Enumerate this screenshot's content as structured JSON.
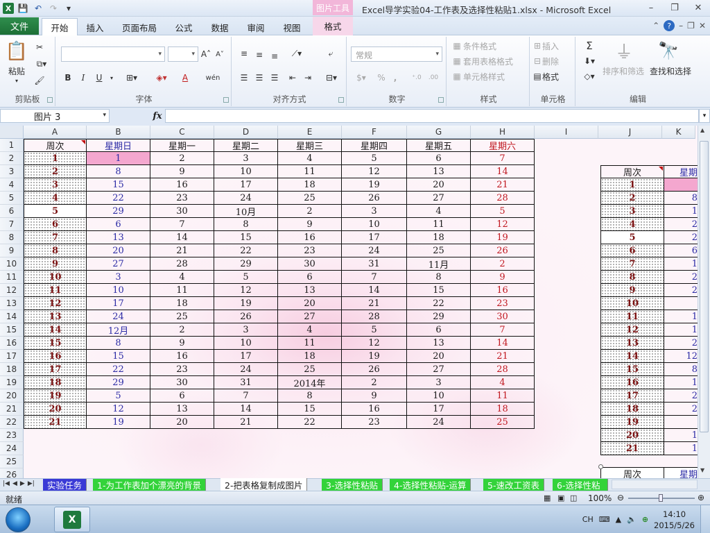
{
  "window": {
    "title": "Excel导学实验04-工作表及选择性粘贴1.xlsx  -  Microsoft Excel",
    "context_tab_group": "图片工具",
    "controls": {
      "minimize": "–",
      "restore": "❐",
      "close": "✕"
    }
  },
  "quick_access": {
    "save_icon": "💾",
    "undo_icon": "↶",
    "redo_icon": "↷",
    "customize_icon": "▾"
  },
  "ribbon_tabs": {
    "file": "文件",
    "tabs": [
      "开始",
      "插入",
      "页面布局",
      "公式",
      "数据",
      "审阅",
      "视图"
    ],
    "format_tab": "格式",
    "active": "开始"
  },
  "ribbon": {
    "clipboard": {
      "label": "剪贴板",
      "paste": "粘贴"
    },
    "font": {
      "label": "字体",
      "bold": "B",
      "italic": "I",
      "underline": "U",
      "grow": "A˄",
      "shrink": "A˅",
      "font_color": "A",
      "phonetic": "wén"
    },
    "alignment": {
      "label": "对齐方式"
    },
    "number": {
      "label": "数字",
      "format_value": "常规",
      "percent": "%",
      "comma": ",",
      "inc_decimal": ".0→.00",
      "dec_decimal": ".00→.0"
    },
    "styles": {
      "label": "样式",
      "conditional": "条件格式",
      "table_format": "套用表格格式",
      "cell_styles": "单元格样式"
    },
    "cells": {
      "label": "单元格",
      "insert": "插入",
      "delete": "删除",
      "format": "格式"
    },
    "editing": {
      "label": "编辑",
      "sum": "Σ",
      "sort_filter": "排序和筛选",
      "find_select": "查找和选择"
    }
  },
  "formula_bar": {
    "name_box": "图片 3",
    "fx": "fx",
    "value": ""
  },
  "columns": [
    "A",
    "B",
    "C",
    "D",
    "E",
    "F",
    "G",
    "H",
    "I",
    "J",
    "K"
  ],
  "rows": [
    "1",
    "2",
    "3",
    "4",
    "5",
    "6",
    "7",
    "8",
    "9",
    "10",
    "11",
    "12",
    "13",
    "14",
    "15",
    "16",
    "17",
    "18",
    "19",
    "20",
    "21",
    "22",
    "23",
    "24",
    "25",
    "26"
  ],
  "calendar": {
    "headers": [
      "周次",
      "星期日",
      "星期一",
      "星期二",
      "星期三",
      "星期四",
      "星期五",
      "星期六"
    ],
    "rows": [
      [
        "1",
        "1",
        "2",
        "3",
        "4",
        "5",
        "6",
        "7"
      ],
      [
        "2",
        "8",
        "9",
        "10",
        "11",
        "12",
        "13",
        "14"
      ],
      [
        "3",
        "15",
        "16",
        "17",
        "18",
        "19",
        "20",
        "21"
      ],
      [
        "4",
        "22",
        "23",
        "24",
        "25",
        "26",
        "27",
        "28"
      ],
      [
        "5",
        "29",
        "30",
        "10月",
        "2",
        "3",
        "4",
        "5"
      ],
      [
        "6",
        "6",
        "7",
        "8",
        "9",
        "10",
        "11",
        "12"
      ],
      [
        "7",
        "13",
        "14",
        "15",
        "16",
        "17",
        "18",
        "19"
      ],
      [
        "8",
        "20",
        "21",
        "22",
        "23",
        "24",
        "25",
        "26"
      ],
      [
        "9",
        "27",
        "28",
        "29",
        "30",
        "31",
        "11月",
        "2"
      ],
      [
        "10",
        "3",
        "4",
        "5",
        "6",
        "7",
        "8",
        "9"
      ],
      [
        "11",
        "10",
        "11",
        "12",
        "13",
        "14",
        "15",
        "16"
      ],
      [
        "12",
        "17",
        "18",
        "19",
        "20",
        "21",
        "22",
        "23"
      ],
      [
        "13",
        "24",
        "25",
        "26",
        "27",
        "28",
        "29",
        "30"
      ],
      [
        "14",
        "12月",
        "2",
        "3",
        "4",
        "5",
        "6",
        "7"
      ],
      [
        "15",
        "8",
        "9",
        "10",
        "11",
        "12",
        "13",
        "14"
      ],
      [
        "16",
        "15",
        "16",
        "17",
        "18",
        "19",
        "20",
        "21"
      ],
      [
        "17",
        "22",
        "23",
        "24",
        "25",
        "26",
        "27",
        "28"
      ],
      [
        "18",
        "29",
        "30",
        "31",
        "2014年",
        "2",
        "3",
        "4"
      ],
      [
        "19",
        "5",
        "6",
        "7",
        "8",
        "9",
        "10",
        "11"
      ],
      [
        "20",
        "12",
        "13",
        "14",
        "15",
        "16",
        "17",
        "18"
      ],
      [
        "21",
        "19",
        "20",
        "21",
        "22",
        "23",
        "24",
        "25"
      ]
    ]
  },
  "picture_copy": {
    "headers": [
      "周次",
      "星期"
    ],
    "weeks": [
      "1",
      "2",
      "3",
      "4",
      "5",
      "6",
      "7",
      "8",
      "9",
      "10",
      "11",
      "12",
      "13",
      "14",
      "15",
      "16",
      "17",
      "18",
      "19",
      "20",
      "21"
    ],
    "sun_partial": [
      "",
      "8",
      "1",
      "2",
      "2",
      "6",
      "1",
      "2",
      "2",
      "",
      "1",
      "1",
      "2",
      "12",
      "8",
      "1",
      "2",
      "2",
      "",
      "1",
      "1"
    ],
    "second_header": [
      "周次",
      "星期"
    ]
  },
  "sheet_tabs": [
    "实验任务",
    "1-为工作表加个漂亮的背景",
    "2-把表格复制成图片",
    "3-选择性粘贴",
    "4-选择性粘贴-运算",
    "5-速改工资表",
    "6-选择性粘"
  ],
  "active_sheet_tab": "2-把表格复制成图片",
  "status": {
    "ready": "就绪",
    "zoom": "100%"
  },
  "taskbar": {
    "ime": "CH",
    "time": "14:10",
    "date": "2015/5/26"
  },
  "colors": {
    "file_tab": "#2a8446",
    "sheet_tab_blue": "#3a3ad6",
    "sheet_tab_green": "#33d33a",
    "sunday": "#2a2aa5",
    "saturday": "#c0171f",
    "selected_cell": "#f4a7cf"
  }
}
